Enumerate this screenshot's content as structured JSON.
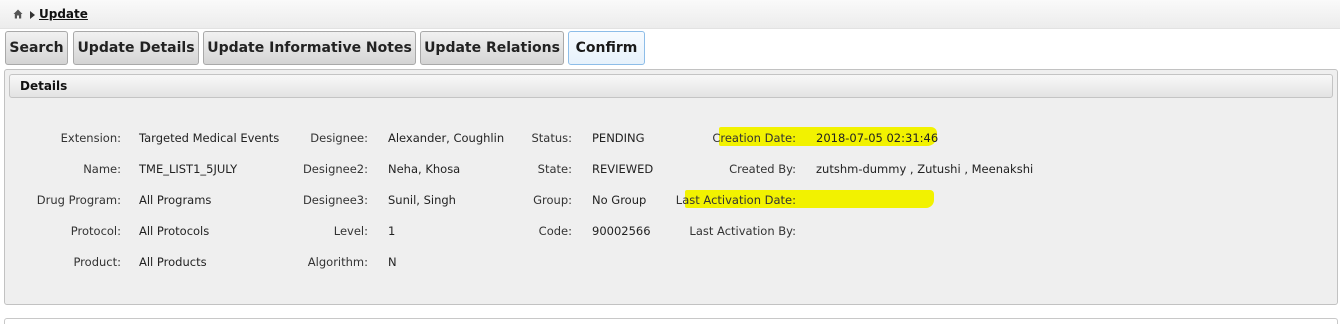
{
  "breadcrumb": {
    "current": "Update"
  },
  "tabs": [
    "Search",
    "Update Details",
    "Update Informative Notes",
    "Update Relations",
    "Confirm"
  ],
  "active_tab": "Confirm",
  "details": {
    "title": "Details",
    "fields": {
      "extension": {
        "label": "Extension:",
        "value": "Targeted Medical Events"
      },
      "name": {
        "label": "Name:",
        "value": "TME_LIST1_5JULY"
      },
      "drug_program": {
        "label": "Drug Program:",
        "value": "All Programs"
      },
      "protocol": {
        "label": "Protocol:",
        "value": "All Protocols"
      },
      "product": {
        "label": "Product:",
        "value": "All Products"
      },
      "designee": {
        "label": "Designee:",
        "value": "Alexander, Coughlin"
      },
      "designee2": {
        "label": "Designee2:",
        "value": "Neha, Khosa"
      },
      "designee3": {
        "label": "Designee3:",
        "value": "Sunil, Singh"
      },
      "level": {
        "label": "Level:",
        "value": "1"
      },
      "algorithm": {
        "label": "Algorithm:",
        "value": "N"
      },
      "status": {
        "label": "Status:",
        "value": "PENDING"
      },
      "state": {
        "label": "State:",
        "value": "REVIEWED"
      },
      "group": {
        "label": "Group:",
        "value": "No Group"
      },
      "code": {
        "label": "Code:",
        "value": "90002566"
      },
      "creation_date": {
        "label": "Creation Date:",
        "value": "2018-07-05 02:31:46"
      },
      "created_by": {
        "label": "Created By:",
        "value": "zutshm-dummy , Zutushi , Meenakshi"
      },
      "last_activation_date": {
        "label": "Last Activation Date:",
        "value": ""
      },
      "last_activation_by": {
        "label": "Last Activation By:",
        "value": ""
      }
    }
  },
  "highlight_color": "#f2f200",
  "icons": {
    "home": "home-icon",
    "separator": "chevron-right-icon"
  }
}
